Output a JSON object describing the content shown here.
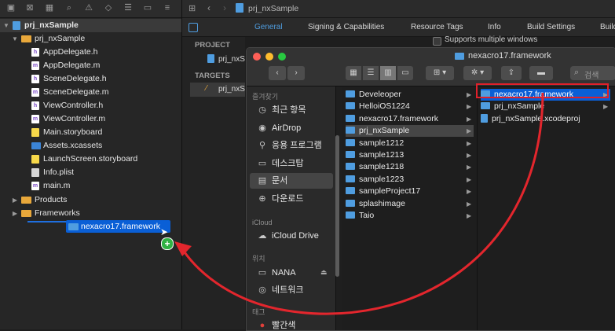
{
  "navigator": {
    "project": "prj_nxSample",
    "group": "prj_nxSample",
    "files": [
      {
        "name": "AppDelegate.h",
        "kind": "h"
      },
      {
        "name": "AppDelegate.m",
        "kind": "m"
      },
      {
        "name": "SceneDelegate.h",
        "kind": "h"
      },
      {
        "name": "SceneDelegate.m",
        "kind": "m"
      },
      {
        "name": "ViewController.h",
        "kind": "h"
      },
      {
        "name": "ViewController.m",
        "kind": "m"
      },
      {
        "name": "Main.storyboard",
        "kind": "sb"
      },
      {
        "name": "Assets.xcassets",
        "kind": "asset"
      },
      {
        "name": "LaunchScreen.storyboard",
        "kind": "sb"
      },
      {
        "name": "Info.plist",
        "kind": "plist"
      },
      {
        "name": "main.m",
        "kind": "m"
      }
    ],
    "products": "Products",
    "frameworks": "Frameworks",
    "drag_item": "nexacro17.framework"
  },
  "editor": {
    "breadcrumb": "prj_nxSample",
    "tabs": [
      "General",
      "Signing & Capabilities",
      "Resource Tags",
      "Info",
      "Build Settings",
      "Build"
    ],
    "active_tab": "General",
    "project_header": "PROJECT",
    "project_item": "prj_nxS",
    "targets_header": "TARGETS",
    "target_item": "prj_nxS",
    "checkbox_label": "Supports multiple windows"
  },
  "finder": {
    "title": "nexacro17.framework",
    "search_placeholder": "검색",
    "sidebar": {
      "favorites_header": "즐겨찾기",
      "favorites": [
        {
          "label": "최근 항목",
          "icon": "clock-icon"
        },
        {
          "label": "AirDrop",
          "icon": "airdrop-icon"
        },
        {
          "label": "응용 프로그램",
          "icon": "apps-icon"
        },
        {
          "label": "데스크탑",
          "icon": "desktop-icon"
        },
        {
          "label": "문서",
          "icon": "document-icon"
        },
        {
          "label": "다운로드",
          "icon": "download-icon"
        }
      ],
      "icloud_header": "iCloud",
      "icloud_item": "iCloud Drive",
      "locations_header": "위치",
      "locations": [
        "NANA",
        "네트워크"
      ],
      "tags_header": "태그",
      "tag_item": "빨간색"
    },
    "column1": [
      "Develeoper",
      "HelloiOS1224",
      "nexacro17.framework",
      "prj_nxSample",
      "sample1212",
      "sample1213",
      "sample1218",
      "sample1223",
      "sampleProject17",
      "splashimage",
      "Taio"
    ],
    "column1_selected": "prj_nxSample",
    "column2": [
      {
        "name": "nexacro17.framework",
        "type": "folder",
        "arrow": true
      },
      {
        "name": "prj_nxSample",
        "type": "folder",
        "arrow": true
      },
      {
        "name": "prj_nxSample.xcodeproj",
        "type": "file",
        "arrow": false
      }
    ],
    "column2_selected": "nexacro17.framework"
  },
  "colors": {
    "selection_blue": "#0a5fd6",
    "highlight_red": "#e0202a",
    "arrow_red": "#e3262d",
    "add_badge": "#2fb243",
    "folder_blue": "#4f9de0",
    "folder_yellow": "#e9a83b"
  }
}
